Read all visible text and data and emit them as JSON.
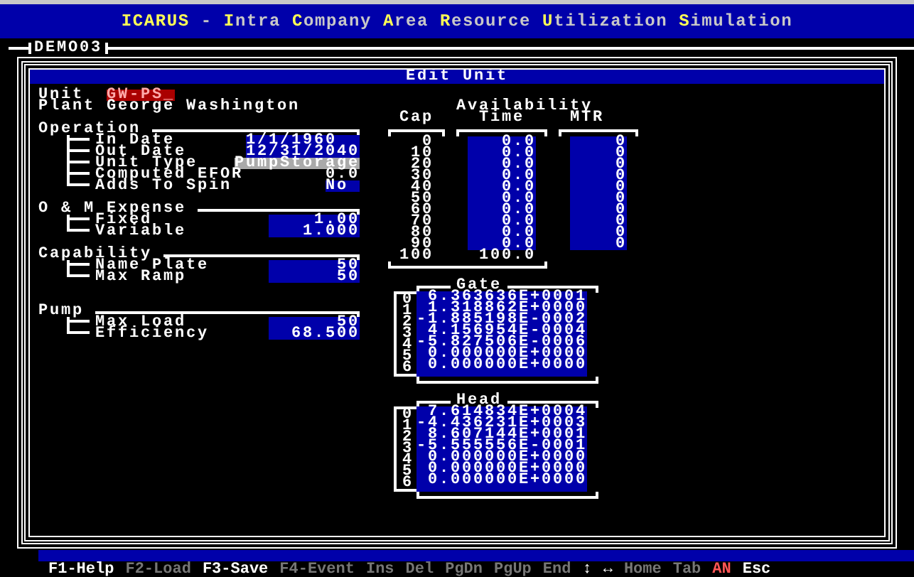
{
  "app_title": [
    {
      "text": "ICARUS",
      "highlight": true
    },
    {
      "text": " - ",
      "highlight": false
    },
    {
      "text": "I",
      "highlight": true
    },
    {
      "text": "ntra ",
      "highlight": false
    },
    {
      "text": "C",
      "highlight": true
    },
    {
      "text": "ompany ",
      "highlight": false
    },
    {
      "text": "A",
      "highlight": true
    },
    {
      "text": "rea ",
      "highlight": false
    },
    {
      "text": "R",
      "highlight": true
    },
    {
      "text": "esource ",
      "highlight": false
    },
    {
      "text": "U",
      "highlight": true
    },
    {
      "text": "tilization ",
      "highlight": false
    },
    {
      "text": "S",
      "highlight": true
    },
    {
      "text": "imulation",
      "highlight": false
    }
  ],
  "tab": "DEMO03",
  "dialog_title": "Edit Unit",
  "header_fields": [
    {
      "label": "Unit",
      "value": "GW-PS_",
      "focused": true
    },
    {
      "label": "Plant",
      "value": "George Washington",
      "focused": false
    }
  ],
  "sections": [
    {
      "title": "Operation",
      "fields": [
        {
          "label": "In Date",
          "value": "1/1/1960",
          "kind": "date"
        },
        {
          "label": "Out Date",
          "value": "12/31/2040",
          "kind": "date"
        },
        {
          "label": "Unit Type",
          "value": "PumpStorage",
          "kind": "select"
        },
        {
          "label": "Computed EFOR",
          "value": "0.0",
          "kind": "computed"
        },
        {
          "label": "Adds To Spin",
          "value": "No",
          "kind": "choice"
        }
      ]
    },
    {
      "title": "O & M Expense",
      "fields": [
        {
          "label": "Fixed",
          "value": "1.00",
          "kind": "number"
        },
        {
          "label": "Variable",
          "value": "1.000",
          "kind": "number"
        }
      ]
    },
    {
      "title": "Capability",
      "fields": [
        {
          "label": "Name Plate",
          "value": "50",
          "kind": "number"
        },
        {
          "label": "Max Ramp",
          "value": "50",
          "kind": "number"
        }
      ]
    },
    {
      "title": "Pump",
      "fields": [
        {
          "label": "Max Load",
          "value": "50",
          "kind": "number"
        },
        {
          "label": "Efficiency",
          "value": "68.500",
          "kind": "number"
        }
      ]
    }
  ],
  "availability": {
    "title": "Availability",
    "columns": [
      "Cap",
      "Time",
      "MTR"
    ],
    "rows": [
      {
        "cap": "0",
        "time": "0.0",
        "mtr": "0"
      },
      {
        "cap": "10",
        "time": "0.0",
        "mtr": "0"
      },
      {
        "cap": "20",
        "time": "0.0",
        "mtr": "0"
      },
      {
        "cap": "30",
        "time": "0.0",
        "mtr": "0"
      },
      {
        "cap": "40",
        "time": "0.0",
        "mtr": "0"
      },
      {
        "cap": "50",
        "time": "0.0",
        "mtr": "0"
      },
      {
        "cap": "60",
        "time": "0.0",
        "mtr": "0"
      },
      {
        "cap": "70",
        "time": "0.0",
        "mtr": "0"
      },
      {
        "cap": "80",
        "time": "0.0",
        "mtr": "0"
      },
      {
        "cap": "90",
        "time": "0.0",
        "mtr": "0"
      }
    ],
    "total": {
      "cap": "100",
      "time": "100.0"
    }
  },
  "curves": [
    {
      "title": "Gate",
      "rows": [
        {
          "index": "0",
          "value": "6.363636E+0001"
        },
        {
          "index": "1",
          "value": "1.318862E+0000"
        },
        {
          "index": "2",
          "value": "-1.885198E-0002"
        },
        {
          "index": "3",
          "value": "4.156954E-0004"
        },
        {
          "index": "4",
          "value": "-5.827506E-0006"
        },
        {
          "index": "5",
          "value": "0.000000E+0000"
        },
        {
          "index": "6",
          "value": "0.000000E+0000"
        }
      ]
    },
    {
      "title": "Head",
      "rows": [
        {
          "index": "0",
          "value": "7.614834E+0004"
        },
        {
          "index": "1",
          "value": "-4.436231E+0003"
        },
        {
          "index": "2",
          "value": "8.607144E+0001"
        },
        {
          "index": "3",
          "value": "-5.555556E-0001"
        },
        {
          "index": "4",
          "value": "0.000000E+0000"
        },
        {
          "index": "5",
          "value": "0.000000E+0000"
        },
        {
          "index": "6",
          "value": "0.000000E+0000"
        }
      ]
    }
  ],
  "function_keys": [
    {
      "label": "F1-Help",
      "kind": "key",
      "disabled": false
    },
    {
      "label": "F2-Load",
      "kind": "key",
      "disabled": true
    },
    {
      "label": "F3-Save",
      "kind": "key",
      "disabled": false
    },
    {
      "label": "F4-Event",
      "kind": "key",
      "disabled": true
    },
    {
      "label": "Ins",
      "kind": "key",
      "disabled": true
    },
    {
      "label": "Del",
      "kind": "key",
      "disabled": true
    },
    {
      "label": "PgDn",
      "kind": "key",
      "disabled": true
    },
    {
      "label": "PgUp",
      "kind": "key",
      "disabled": true
    },
    {
      "label": "End",
      "kind": "key",
      "disabled": true
    },
    {
      "label": "↕",
      "kind": "key",
      "disabled": false
    },
    {
      "label": "↔",
      "kind": "key",
      "disabled": false
    },
    {
      "label": "Home",
      "kind": "key",
      "disabled": true
    },
    {
      "label": "Tab",
      "kind": "key",
      "disabled": true
    },
    {
      "label": "AN",
      "kind": "indicator",
      "disabled": false
    },
    {
      "label": "Esc",
      "kind": "key",
      "disabled": false
    }
  ]
}
